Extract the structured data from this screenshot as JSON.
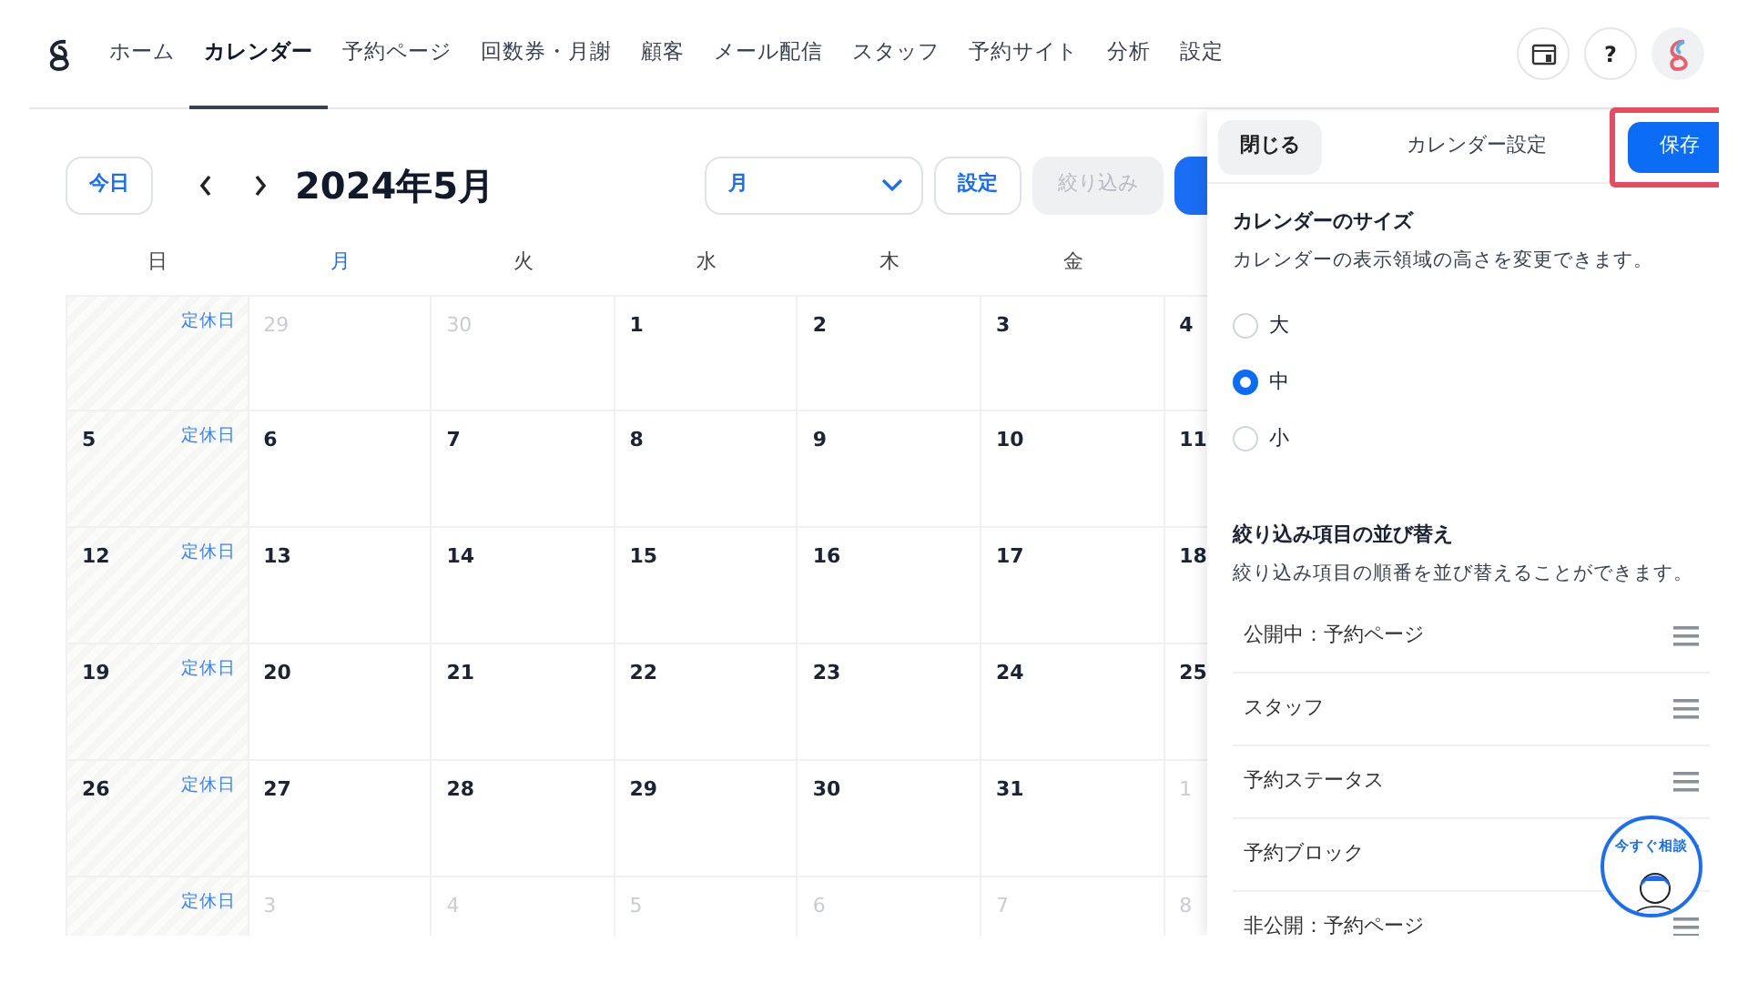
{
  "nav": {
    "items": [
      {
        "label": "ホーム",
        "selected": false
      },
      {
        "label": "カレンダー",
        "selected": true
      },
      {
        "label": "予約ページ",
        "selected": false
      },
      {
        "label": "回数券・月謝",
        "selected": false
      },
      {
        "label": "顧客",
        "selected": false
      },
      {
        "label": "メール配信",
        "selected": false
      },
      {
        "label": "スタッフ",
        "selected": false
      },
      {
        "label": "予約サイト",
        "selected": false
      },
      {
        "label": "分析",
        "selected": false
      },
      {
        "label": "設定",
        "selected": false
      }
    ],
    "help": "?"
  },
  "toolbar": {
    "today": "今日",
    "title": "2024年5月",
    "view": {
      "value": "月"
    },
    "settings": "設定",
    "filter": {
      "label": "絞り込み",
      "disabled": true
    }
  },
  "calendar": {
    "weekdays": [
      {
        "label": "日",
        "current": false
      },
      {
        "label": "月",
        "current": true
      },
      {
        "label": "火",
        "current": false
      },
      {
        "label": "水",
        "current": false
      },
      {
        "label": "木",
        "current": false
      },
      {
        "label": "金",
        "current": false
      }
    ],
    "weeks": [
      [
        {
          "closed": true,
          "tag": "定休日"
        },
        {
          "label": "29",
          "muted": true
        },
        {
          "label": "30",
          "muted": true
        },
        {
          "label": "1",
          "muted": false
        },
        {
          "label": "2",
          "muted": false
        },
        {
          "label": "3",
          "muted": false
        },
        {
          "label": "4",
          "muted": false
        }
      ],
      [
        {
          "label": "5",
          "muted": false,
          "closed": true,
          "tag": "定休日"
        },
        {
          "label": "6",
          "muted": false
        },
        {
          "label": "7",
          "muted": false
        },
        {
          "label": "8",
          "muted": false
        },
        {
          "label": "9",
          "muted": false
        },
        {
          "label": "10",
          "muted": false
        },
        {
          "label": "11",
          "muted": false
        }
      ],
      [
        {
          "label": "12",
          "muted": false,
          "closed": true,
          "tag": "定休日"
        },
        {
          "label": "13",
          "muted": false
        },
        {
          "label": "14",
          "muted": false
        },
        {
          "label": "15",
          "muted": false
        },
        {
          "label": "16",
          "muted": false
        },
        {
          "label": "17",
          "muted": false
        },
        {
          "label": "18",
          "muted": false
        }
      ],
      [
        {
          "label": "19",
          "muted": false,
          "closed": true,
          "tag": "定休日"
        },
        {
          "label": "20",
          "muted": false
        },
        {
          "label": "21",
          "muted": false
        },
        {
          "label": "22",
          "muted": false
        },
        {
          "label": "23",
          "muted": false
        },
        {
          "label": "24",
          "muted": false
        },
        {
          "label": "25",
          "muted": false
        }
      ],
      [
        {
          "label": "26",
          "muted": false,
          "closed": true,
          "tag": "定休日"
        },
        {
          "label": "27",
          "muted": false
        },
        {
          "label": "28",
          "muted": false
        },
        {
          "label": "29",
          "muted": false
        },
        {
          "label": "30",
          "muted": false
        },
        {
          "label": "31",
          "muted": false
        },
        {
          "label": "1",
          "muted": true
        }
      ],
      [
        {
          "closed": true,
          "tag": "定休日"
        },
        {
          "label": "3",
          "muted": true
        },
        {
          "label": "4",
          "muted": true
        },
        {
          "label": "5",
          "muted": true
        },
        {
          "label": "6",
          "muted": true
        },
        {
          "label": "7",
          "muted": true
        },
        {
          "label": "8",
          "muted": true
        }
      ]
    ]
  },
  "panel": {
    "close": "閉じる",
    "title": "カレンダー設定",
    "save": {
      "label": "保存",
      "highlighted": true
    },
    "size": {
      "title": "カレンダーのサイズ",
      "description": "カレンダーの表示領域の高さを変更できます。",
      "options": [
        {
          "label": "大",
          "selected": false
        },
        {
          "label": "中",
          "selected": true
        },
        {
          "label": "小",
          "selected": false
        }
      ]
    },
    "order": {
      "title": "絞り込み項目の並び替え",
      "description": "絞り込み項目の順番を並び替えることができます。",
      "items": [
        "公開中：予約ページ",
        "スタッフ",
        "予約ステータス",
        "予約ブロック",
        "非公開：予約ページ"
      ]
    }
  },
  "chat": {
    "label": "今すぐ相談"
  }
}
